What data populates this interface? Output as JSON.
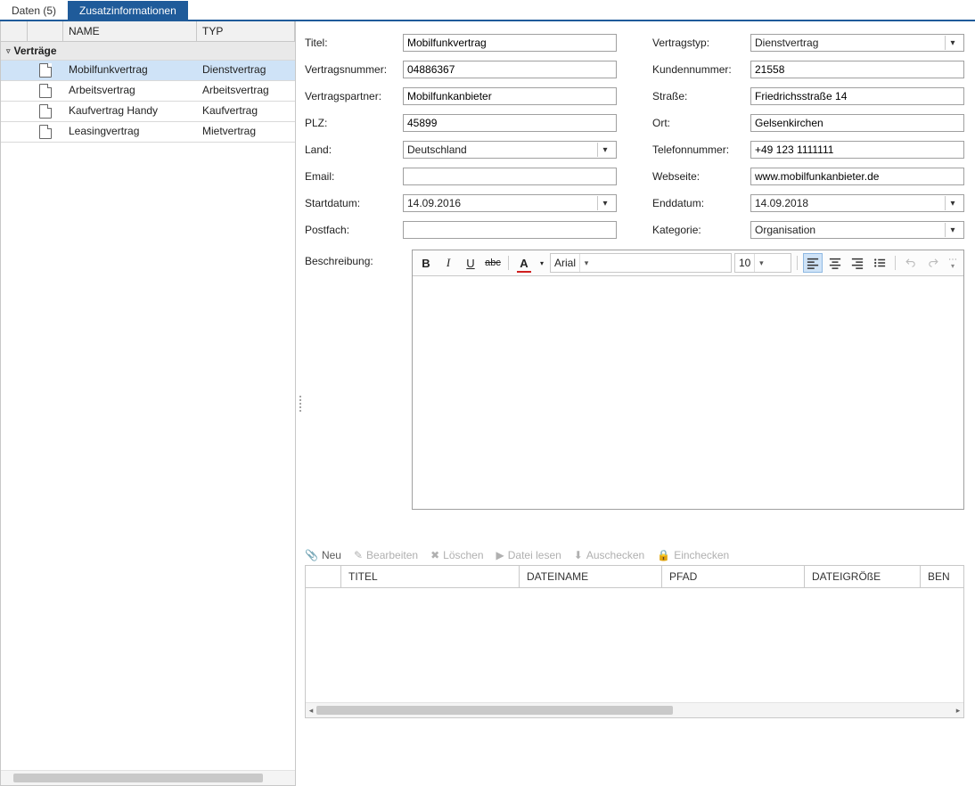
{
  "tabs": {
    "data_label": "Daten (5)",
    "extra_label": "Zusatzinformationen"
  },
  "west": {
    "headers": {
      "name": "NAME",
      "typ": "TYP"
    },
    "group_label": "Verträge",
    "rows": [
      {
        "name": "Mobilfunkvertrag",
        "typ": "Dienstvertrag",
        "selected": true
      },
      {
        "name": "Arbeitsvertrag",
        "typ": "Arbeitsvertrag",
        "selected": false
      },
      {
        "name": "Kaufvertrag Handy",
        "typ": "Kaufvertrag",
        "selected": false
      },
      {
        "name": "Leasingvertrag",
        "typ": "Mietvertrag",
        "selected": false
      }
    ]
  },
  "form": {
    "labels": {
      "titel": "Titel:",
      "vertragstyp": "Vertragstyp:",
      "vertragsnummer": "Vertragsnummer:",
      "kundennummer": "Kundennummer:",
      "vertragspartner": "Vertragspartner:",
      "strasse": "Straße:",
      "plz": "PLZ:",
      "ort": "Ort:",
      "land": "Land:",
      "telefon": "Telefonnummer:",
      "email": "Email:",
      "webseite": "Webseite:",
      "startdatum": "Startdatum:",
      "enddatum": "Enddatum:",
      "postfach": "Postfach:",
      "kategorie": "Kategorie:",
      "beschreibung": "Beschreibung:"
    },
    "values": {
      "titel": "Mobilfunkvertrag",
      "vertragstyp": "Dienstvertrag",
      "vertragsnummer": "04886367",
      "kundennummer": "21558",
      "vertragspartner": "Mobilfunkanbieter",
      "strasse": "Friedrichsstraße 14",
      "plz": "45899",
      "ort": "Gelsenkirchen",
      "land": "Deutschland",
      "telefon": "+49 123 1111111",
      "email": "",
      "webseite": "www.mobilfunkanbieter.de",
      "startdatum": "14.09.2016",
      "enddatum": "14.09.2018",
      "postfach": "",
      "kategorie": "Organisation"
    }
  },
  "editor": {
    "font": "Arial",
    "size": "10"
  },
  "attachments": {
    "toolbar": {
      "neu": "Neu",
      "bearbeiten": "Bearbeiten",
      "loeschen": "Löschen",
      "datei_lesen": "Datei lesen",
      "auschecken": "Auschecken",
      "einchecken": "Einchecken"
    },
    "headers": {
      "titel": "TITEL",
      "dateiname": "DATEINAME",
      "pfad": "PFAD",
      "dateigroesse": "DATEIGRÖßE",
      "ben": "BEN"
    }
  }
}
